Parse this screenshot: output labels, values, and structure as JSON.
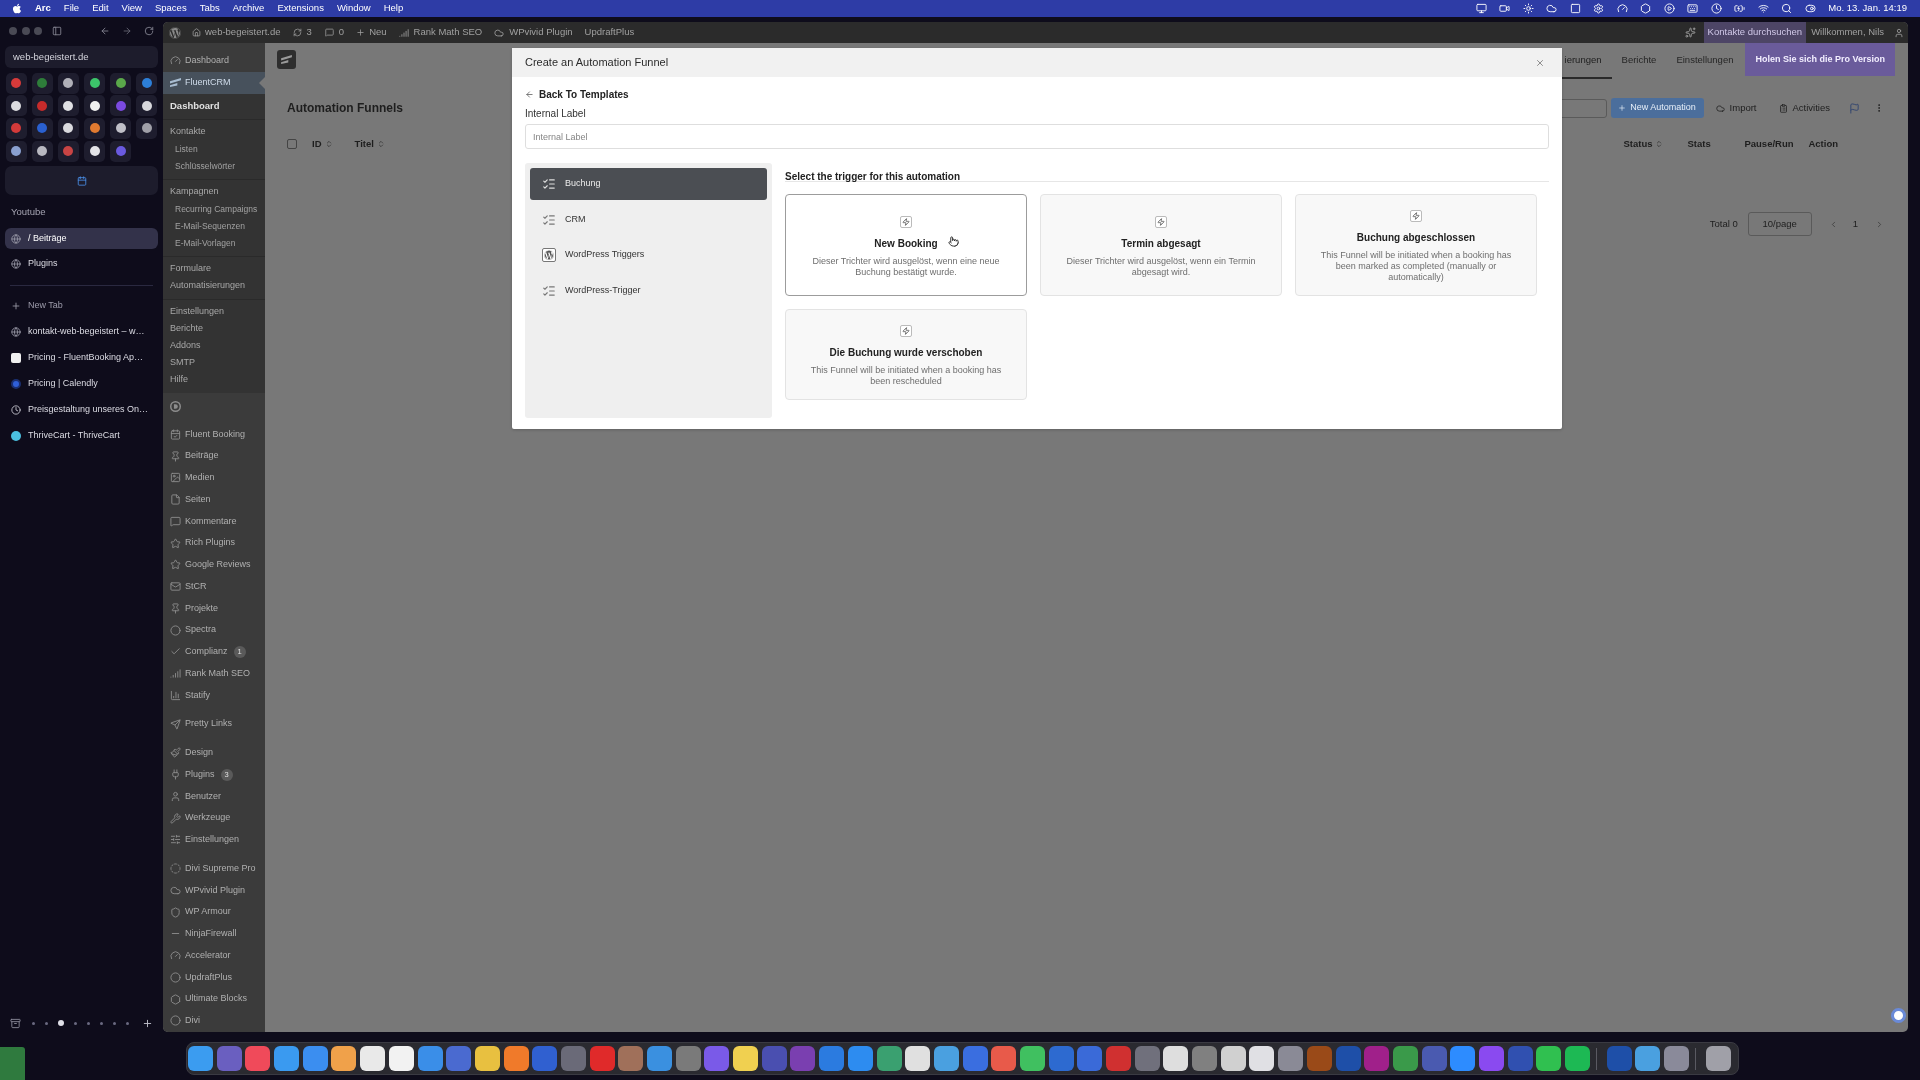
{
  "menu_bar": {
    "app": "Arc",
    "menus": [
      "File",
      "Edit",
      "View",
      "Spaces",
      "Tabs",
      "Archive",
      "Extensions",
      "Window",
      "Help"
    ],
    "clock": "Mo. 13. Jan. 14:19"
  },
  "browser_sidebar": {
    "address": "web-begeistert.de",
    "folder": "Youtube",
    "folder_tabs": [
      {
        "title": "/ Beiträge",
        "selected": true
      },
      {
        "title": "Plugins",
        "selected": false
      }
    ],
    "new_tab": "New Tab",
    "tabs": [
      {
        "title": "kontakt-web-begeistert – w…"
      },
      {
        "title": "Pricing - FluentBooking Ap…"
      },
      {
        "title": "Pricing | Calendly"
      },
      {
        "title": "Preisgestaltung unseres On…"
      },
      {
        "title": "ThriveCart - ThriveCart"
      }
    ],
    "spaces": [
      {
        "selected": false
      },
      {
        "selected": false
      },
      {
        "selected": true
      },
      {
        "selected": false
      },
      {
        "selected": false
      },
      {
        "selected": false
      },
      {
        "selected": false
      },
      {
        "selected": false
      }
    ]
  },
  "admin_bar": {
    "site": "web-begeistert.de",
    "updates": "3",
    "comments": "0",
    "new": "Neu",
    "plugins": [
      "Rank Math SEO",
      "WPvivid Plugin",
      "UpdraftPlus"
    ],
    "contact_search": "Kontakte durchsuchen",
    "greeting": "Willkommen, Nils"
  },
  "admin_menu": {
    "sections": [
      {
        "items": [
          {
            "label": "Dashboard",
            "selected": false
          },
          {
            "label": "FluentCRM",
            "selected": true,
            "submenu": [
              {
                "items": [
                  {
                    "label": "Dashboard",
                    "selected": true
                  }
                ]
              },
              {
                "items": [
                  {
                    "label": "Kontakte",
                    "selected": false,
                    "children": [
                      {
                        "label": "Listen",
                        "selected": false
                      },
                      {
                        "label": "Schlüsselwörter",
                        "selected": false
                      }
                    ]
                  }
                ]
              },
              {
                "items": [
                  {
                    "label": "Kampagnen",
                    "selected": false,
                    "children": [
                      {
                        "label": "Recurring Campaigns",
                        "selected": false
                      },
                      {
                        "label": "E-Mail-Sequenzen",
                        "selected": false
                      },
                      {
                        "label": "E-Mail-Vorlagen",
                        "selected": false
                      }
                    ]
                  }
                ]
              },
              {
                "items": [
                  {
                    "label": "Formulare",
                    "selected": false
                  },
                  {
                    "label": "Automatisierungen",
                    "selected": false
                  }
                ]
              },
              {
                "items": [
                  {
                    "label": "Einstellungen",
                    "selected": false
                  },
                  {
                    "label": "Berichte",
                    "selected": false
                  },
                  {
                    "label": "Addons",
                    "selected": false
                  },
                  {
                    "label": "SMTP",
                    "selected": false
                  },
                  {
                    "label": "Hilfe",
                    "selected": false
                  }
                ]
              }
            ]
          }
        ]
      },
      {
        "items": [
          {
            "label": "Fluent Booking",
            "selected": false
          },
          {
            "label": "Beiträge",
            "selected": false
          },
          {
            "label": "Medien",
            "selected": false
          },
          {
            "label": "Seiten",
            "selected": false
          },
          {
            "label": "Kommentare",
            "selected": false
          },
          {
            "label": "Rich Plugins",
            "selected": false
          },
          {
            "label": "Google Reviews",
            "selected": false
          },
          {
            "label": "StCR",
            "selected": false
          },
          {
            "label": "Projekte",
            "selected": false
          },
          {
            "label": "Spectra",
            "selected": false
          },
          {
            "label": "Complianz",
            "selected": false,
            "badge": "1"
          },
          {
            "label": "Rank Math SEO",
            "selected": false
          },
          {
            "label": "Statify",
            "selected": false
          }
        ]
      },
      {
        "items": [
          {
            "label": "Pretty Links",
            "selected": false
          }
        ]
      },
      {
        "items": [
          {
            "label": "Design",
            "selected": false
          },
          {
            "label": "Plugins",
            "selected": false,
            "badge": "3"
          },
          {
            "label": "Benutzer",
            "selected": false
          },
          {
            "label": "Werkzeuge",
            "selected": false
          },
          {
            "label": "Einstellungen",
            "selected": false
          }
        ]
      },
      {
        "items": [
          {
            "label": "Divi Supreme Pro",
            "selected": false
          },
          {
            "label": "WPvivid Plugin",
            "selected": false
          },
          {
            "label": "WP Armour",
            "selected": false
          },
          {
            "label": "NinjaFirewall",
            "selected": false
          },
          {
            "label": "Accelerator",
            "selected": false
          },
          {
            "label": "UpdraftPlus",
            "selected": false
          },
          {
            "label": "Ultimate Blocks",
            "selected": false
          },
          {
            "label": "Divi",
            "selected": false
          }
        ]
      }
    ]
  },
  "crm_page": {
    "title": "Automation Funnels",
    "nav": [
      {
        "label": "ierungen",
        "selected": true
      },
      {
        "label": "Berichte",
        "selected": false
      },
      {
        "label": "Einstellungen",
        "selected": false
      }
    ],
    "pro_button": "Holen Sie sich die Pro Version",
    "actions": {
      "new": "New Automation",
      "import": "Import",
      "activities": "Activities"
    },
    "select_all": {
      "checked": false
    },
    "columns_left": [
      {
        "label": "ID",
        "sortable": true
      },
      {
        "label": "Titel",
        "sortable": true
      }
    ],
    "columns_right": [
      {
        "label": "Status",
        "sortable": true
      },
      {
        "label": "Stats",
        "sortable": false
      },
      {
        "label": "Pause/Run",
        "sortable": false
      },
      {
        "label": "Action",
        "sortable": false
      }
    ],
    "pagination": {
      "total": "Total 0",
      "page_size": "10/page",
      "page": "1"
    }
  },
  "modal": {
    "title": "Create an Automation Funnel",
    "back": "Back To Templates",
    "field": {
      "label": "Internal Label",
      "placeholder": "Internal Label"
    },
    "categories": [
      {
        "label": "Buchung",
        "selected": true
      },
      {
        "label": "CRM",
        "selected": false
      },
      {
        "label": "WordPress Triggers",
        "selected": false
      },
      {
        "label": "WordPress-Trigger",
        "selected": false
      }
    ],
    "heading": "Select the trigger for this automation",
    "triggers": [
      {
        "title": "New Booking",
        "description": "Dieser Trichter wird ausgelöst, wenn eine neue Buchung bestätigt wurde.",
        "selected": true
      },
      {
        "title": "Termin abgesagt",
        "description": "Dieser Trichter wird ausgelöst, wenn ein Termin abgesagt wird.",
        "selected": false
      },
      {
        "title": "Buchung abgeschlossen",
        "description": "This Funnel will be initiated when a booking has been marked as completed (manually or automatically)",
        "selected": false
      },
      {
        "title": "Die Buchung wurde verschoben",
        "description": "This Funnel will be initiated when a booking has been rescheduled",
        "selected": false
      }
    ]
  }
}
